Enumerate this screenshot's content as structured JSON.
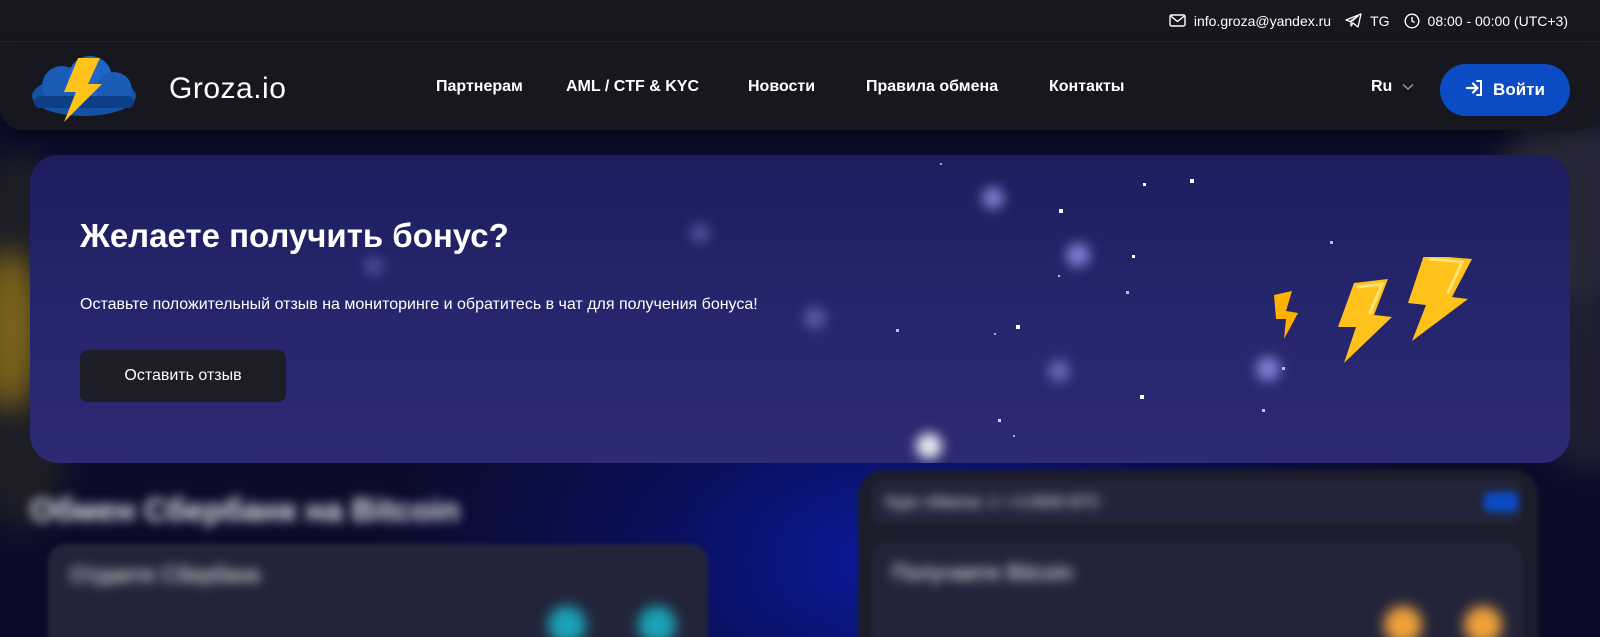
{
  "topbar": {
    "email": "info.groza@yandex.ru",
    "telegram": "TG",
    "hours": "08:00 - 00:00 (UTC+3)",
    "icons": [
      "mail-icon",
      "telegram-icon",
      "clock-icon"
    ]
  },
  "header": {
    "brand": "Groza.io",
    "nav": [
      {
        "label": "Партнерам"
      },
      {
        "label": "AML / CTF & KYC"
      },
      {
        "label": "Новости"
      },
      {
        "label": "Правила обмена"
      },
      {
        "label": "Контакты"
      }
    ],
    "language": "Ru",
    "login_label": "Войти"
  },
  "banner": {
    "title": "Желаете получить бонус?",
    "text": "Оставьте положительный отзыв на мониторинге и обратитесь в чат для получения бонуса!",
    "button_label": "Оставить отзыв"
  },
  "lower": {
    "exchange_title": "Обмен Сбербанк на Bitcoin",
    "give_title": "Отдаете Сбербанк",
    "rate_text": "Курс обмена: 1 = 0.0000 BTC",
    "receive_title": "Получаете Bitcoin"
  },
  "colors": {
    "primary_button": "#0b4bc4",
    "header_bg": "#16171f",
    "banner_bg": "#26266e",
    "accent_bolt": "#ffc21a"
  }
}
